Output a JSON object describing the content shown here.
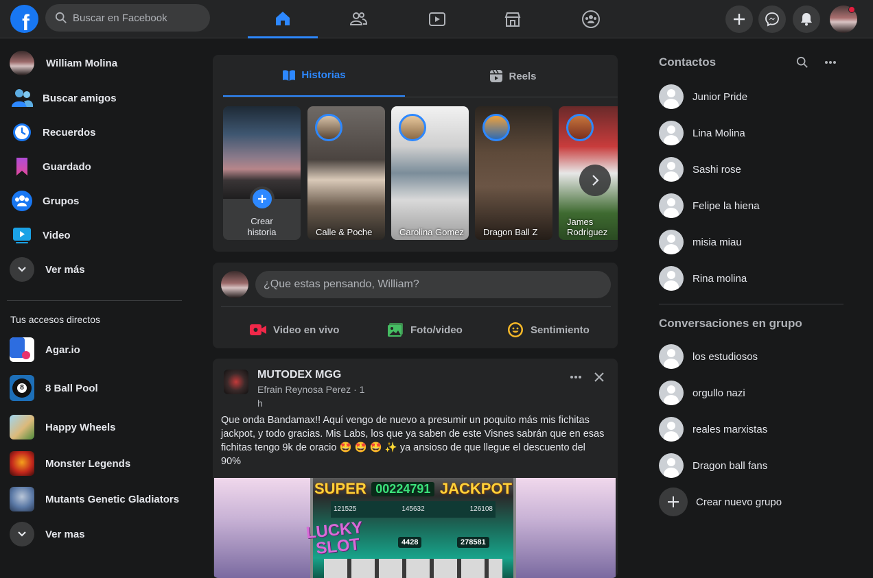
{
  "topbar": {
    "logo": "f",
    "search_placeholder": "Buscar en Facebook",
    "nav_tabs": [
      "home-icon",
      "friends-icon",
      "watch-icon",
      "marketplace-icon",
      "groups-icon"
    ],
    "active_tab": "home"
  },
  "left": {
    "profile_name": "William Molina",
    "items": [
      {
        "label": "Buscar amigos",
        "icon": "friends-icon"
      },
      {
        "label": "Recuerdos",
        "icon": "memories-clock-icon"
      },
      {
        "label": "Guardado",
        "icon": "bookmark-icon"
      },
      {
        "label": "Grupos",
        "icon": "groups-icon"
      },
      {
        "label": "Video",
        "icon": "video-icon"
      },
      {
        "label": "Ver más",
        "icon": "chevron-down-icon"
      }
    ],
    "shortcuts_title": "Tus accesos directos",
    "shortcuts": [
      {
        "label": "Agar.io"
      },
      {
        "label": "8 Ball Pool"
      },
      {
        "label": "Happy Wheels"
      },
      {
        "label": "Monster Legends"
      },
      {
        "label": "Mutants Genetic Gladiators"
      }
    ],
    "see_more": "Ver mas"
  },
  "stories": {
    "tabs": [
      {
        "label": "Historias"
      },
      {
        "label": "Reels"
      }
    ],
    "create_label_1": "Crear",
    "create_label_2": "historia",
    "items": [
      {
        "name": "Calle & Poche"
      },
      {
        "name": "Carolina Gomez"
      },
      {
        "name": "Dragon Ball Z"
      },
      {
        "name": "James Rodriguez"
      }
    ]
  },
  "composer": {
    "placeholder": "¿Que estas pensando, William?",
    "actions": [
      {
        "label": "Video en vivo",
        "color": "#f02849"
      },
      {
        "label": "Foto/video",
        "color": "#45bd62"
      },
      {
        "label": "Sentimiento",
        "color": "#f7b928"
      }
    ]
  },
  "post": {
    "page_name": "MUTODEX MGG",
    "author_line1": "Efrain Reynosa Perez · 1",
    "author_line2": "h",
    "text": "Que onda Bandamax!! Aquí vengo de nuevo a presumir un poquito más mis fichitas jackpot, y todo gracias. Mis Labs, los que ya saben de este Visnes sabrán que en esas fichitas tengo 9k de oracio 🤩 🤩 🤩 ✨ ya ansioso de que llegue el descuento del 90%",
    "image_texts": {
      "super": "SUPER",
      "jackpot": "JACKPOT",
      "counter": "00224791",
      "lucky": "LUCKY",
      "slot": "SLOT",
      "num1": "4428",
      "num2": "278581",
      "p1": "121525",
      "p2": "145632",
      "p3": "126108"
    }
  },
  "right": {
    "contacts_title": "Contactos",
    "contacts": [
      "Junior Pride",
      "Lina Molina",
      "Sashi rose",
      "Felipe la hiena",
      "misia miau",
      "Rina molina"
    ],
    "groups_title": "Conversaciones en grupo",
    "groups": [
      "los estudiosos",
      "orgullo nazi",
      "reales marxistas",
      "Dragon ball fans"
    ],
    "create_group": "Crear nuevo grupo"
  },
  "colors": {
    "accent": "#2d88ff",
    "brand": "#1877f2",
    "bg": "#18191a",
    "card": "#242526"
  }
}
